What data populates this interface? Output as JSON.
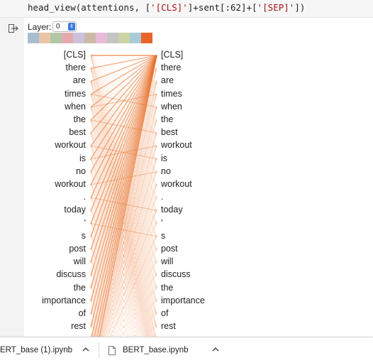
{
  "code_cell": {
    "parts": [
      {
        "text": "head_view(attentions, [",
        "cls": ""
      },
      {
        "text": "'[CLS]'",
        "cls": "str"
      },
      {
        "text": "]+sent[:62]+[",
        "cls": ""
      },
      {
        "text": "'[SEP]'",
        "cls": "str"
      },
      {
        "text": "])",
        "cls": ""
      }
    ]
  },
  "layer": {
    "label": "Layer:",
    "value": "0"
  },
  "head_colors": [
    "#a9bdd1",
    "#e9c5a7",
    "#b2c7a5",
    "#e6aaae",
    "#cdc1dd",
    "#ccbaa8",
    "#e8bcd9",
    "#c4c4c4",
    "#ccd3a5",
    "#a9cbd9",
    "#e8632a"
  ],
  "tokens": [
    "[CLS]",
    "there",
    "are",
    "times",
    "when",
    "the",
    "best",
    "workout",
    "is",
    "no",
    "workout",
    ".",
    "today",
    "'",
    "s",
    "post",
    "will",
    "discuss",
    "the",
    "importance",
    "of",
    "rest"
  ],
  "attention_color": "#e8722e",
  "downloads": [
    {
      "name": "ERT_base (1).ipynb"
    },
    {
      "name": "BERT_base.ipynb"
    }
  ]
}
